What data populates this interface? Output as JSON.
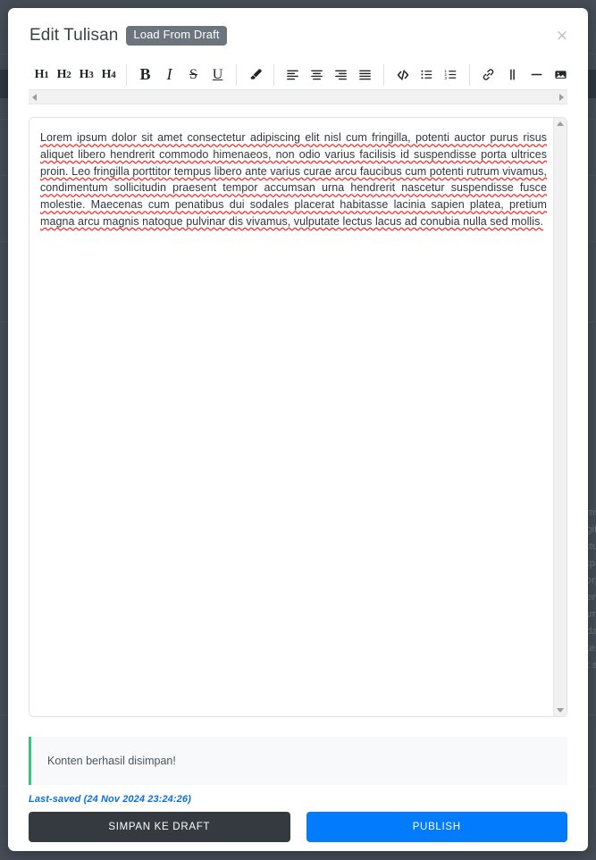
{
  "background": {
    "accent_dark": "#2f3640",
    "base": "#454c56",
    "text_fragments": [
      "ums",
      "agit",
      "rctus",
      "utpa",
      "corp",
      "per",
      "fam",
      "odal",
      "ate",
      "et s"
    ]
  },
  "modal": {
    "title": "Edit Tulisan",
    "load_draft_label": "Load From Draft",
    "close_icon": "close-icon",
    "close_glyph": "×"
  },
  "toolbar": {
    "groups": [
      {
        "name": "headings",
        "buttons": [
          {
            "name": "heading-1-button",
            "label": "H",
            "sub": "1"
          },
          {
            "name": "heading-2-button",
            "label": "H",
            "sub": "2"
          },
          {
            "name": "heading-3-button",
            "label": "H",
            "sub": "3"
          },
          {
            "name": "heading-4-button",
            "label": "H",
            "sub": "4"
          }
        ]
      },
      {
        "name": "text-format",
        "buttons": [
          {
            "name": "bold-button",
            "label": "B"
          },
          {
            "name": "italic-button",
            "label": "I"
          },
          {
            "name": "strikethrough-button",
            "label": "S"
          },
          {
            "name": "underline-button",
            "label": "U"
          }
        ]
      },
      {
        "name": "highlight",
        "buttons": [
          {
            "name": "highlighter-icon",
            "label": ""
          }
        ]
      },
      {
        "name": "alignment",
        "buttons": [
          {
            "name": "align-left-icon",
            "label": ""
          },
          {
            "name": "align-center-icon",
            "label": ""
          },
          {
            "name": "align-right-icon",
            "label": ""
          },
          {
            "name": "align-justify-icon",
            "label": ""
          }
        ]
      },
      {
        "name": "blocks",
        "buttons": [
          {
            "name": "code-icon",
            "label": ""
          },
          {
            "name": "bullet-list-icon",
            "label": ""
          },
          {
            "name": "ordered-list-icon",
            "label": ""
          }
        ]
      },
      {
        "name": "insert",
        "buttons": [
          {
            "name": "link-icon",
            "label": ""
          },
          {
            "name": "blockquote-icon",
            "label": ""
          },
          {
            "name": "horizontal-rule-icon",
            "label": ""
          },
          {
            "name": "image-icon",
            "label": ""
          },
          {
            "name": "video-icon",
            "label": ""
          }
        ]
      }
    ],
    "scroll_left_icon": "scroll-arrow-left-icon",
    "scroll_right_icon": "scroll-arrow-right-icon"
  },
  "editor": {
    "content": "Lorem ipsum dolor sit amet consectetur adipiscing elit nisl cum fringilla, potenti auctor purus risus aliquet libero hendrerit commodo himenaeos, non odio varius facilisis id suspendisse porta ultrices proin. Leo fringilla porttitor tempus libero ante varius curae arcu faucibus cum potenti rutrum vivamus, condimentum sollicitudin praesent tempor accumsan urna hendrerit nascetur suspendisse fusce molestie. Maecenas cum penatibus dui sodales placerat habitasse lacinia sapien platea, pretium magna arcu magnis natoque pulvinar dis vivamus, vulputate lectus lacus ad conubia nulla sed mollis.",
    "scroll_up_icon": "scroll-arrow-up-icon",
    "scroll_down_icon": "scroll-arrow-down-icon"
  },
  "alert": {
    "message": "Konten berhasil disimpan!",
    "accent_color": "#34c77b"
  },
  "status": {
    "last_saved": "Last-saved (24 Nov 2024 23:24:26)"
  },
  "footer": {
    "draft_label": "SIMPAN KE DRAFT",
    "publish_label": "PUBLISH",
    "draft_color": "#343a40",
    "publish_color": "#027bfc"
  }
}
